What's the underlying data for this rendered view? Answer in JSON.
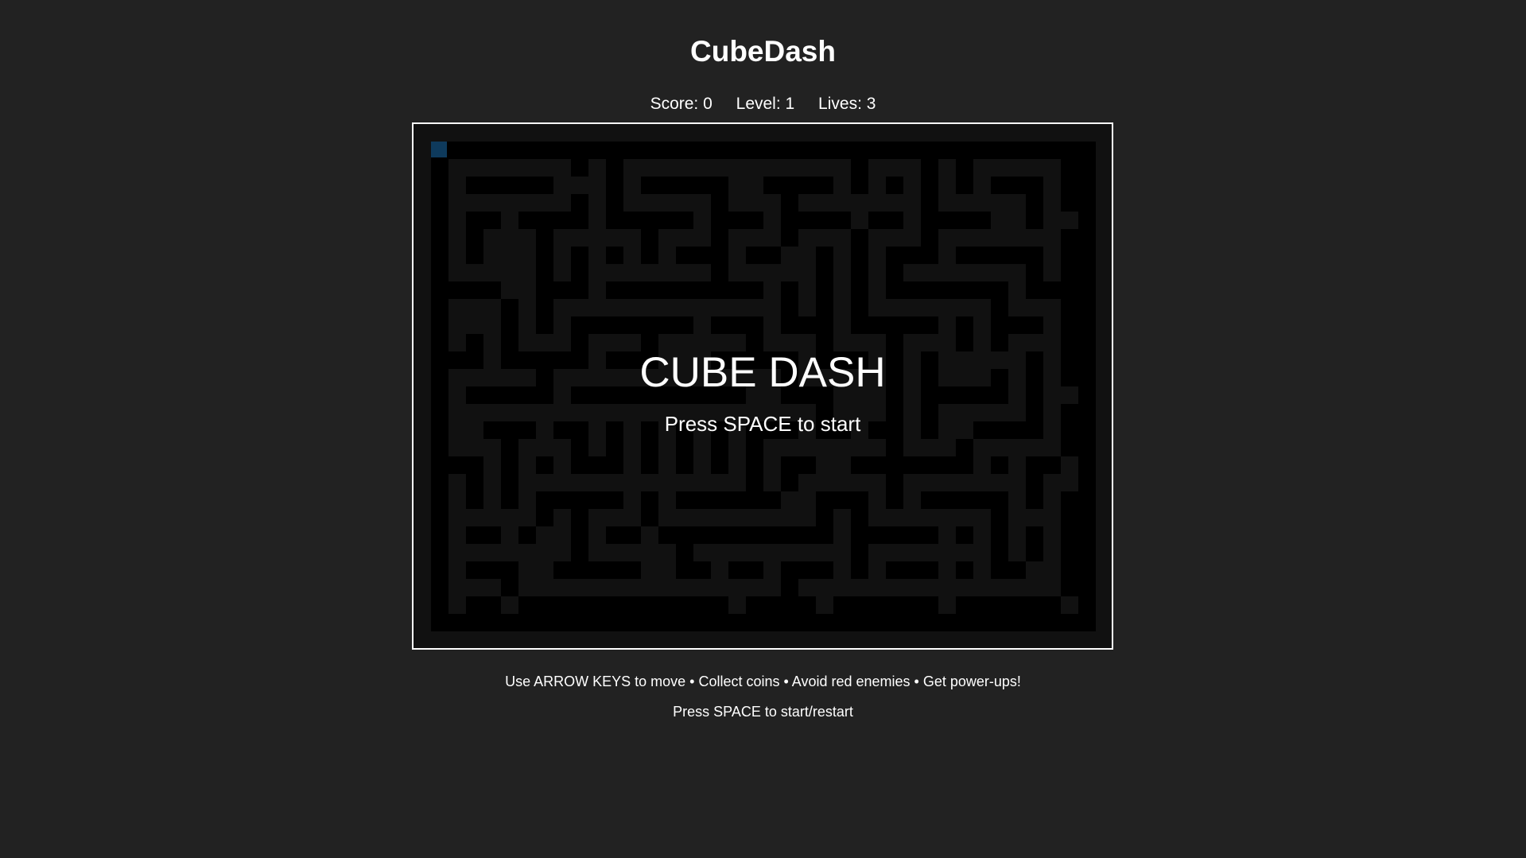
{
  "title": "CubeDash",
  "stats": {
    "score_label": "Score: 0",
    "level_label": "Level: 1",
    "lives_label": "Lives: 3"
  },
  "game": {
    "overlay_title": "CUBE DASH",
    "overlay_prompt": "Press SPACE to start",
    "player_color": "#0e3a5c",
    "wall_color": "#000000",
    "floor_color": "#111111"
  },
  "footer": {
    "instructions": "Use ARROW KEYS to move • Collect coins • Avoid red enemies • Get power-ups!",
    "restart_hint": "Press SPACE to start/restart"
  }
}
